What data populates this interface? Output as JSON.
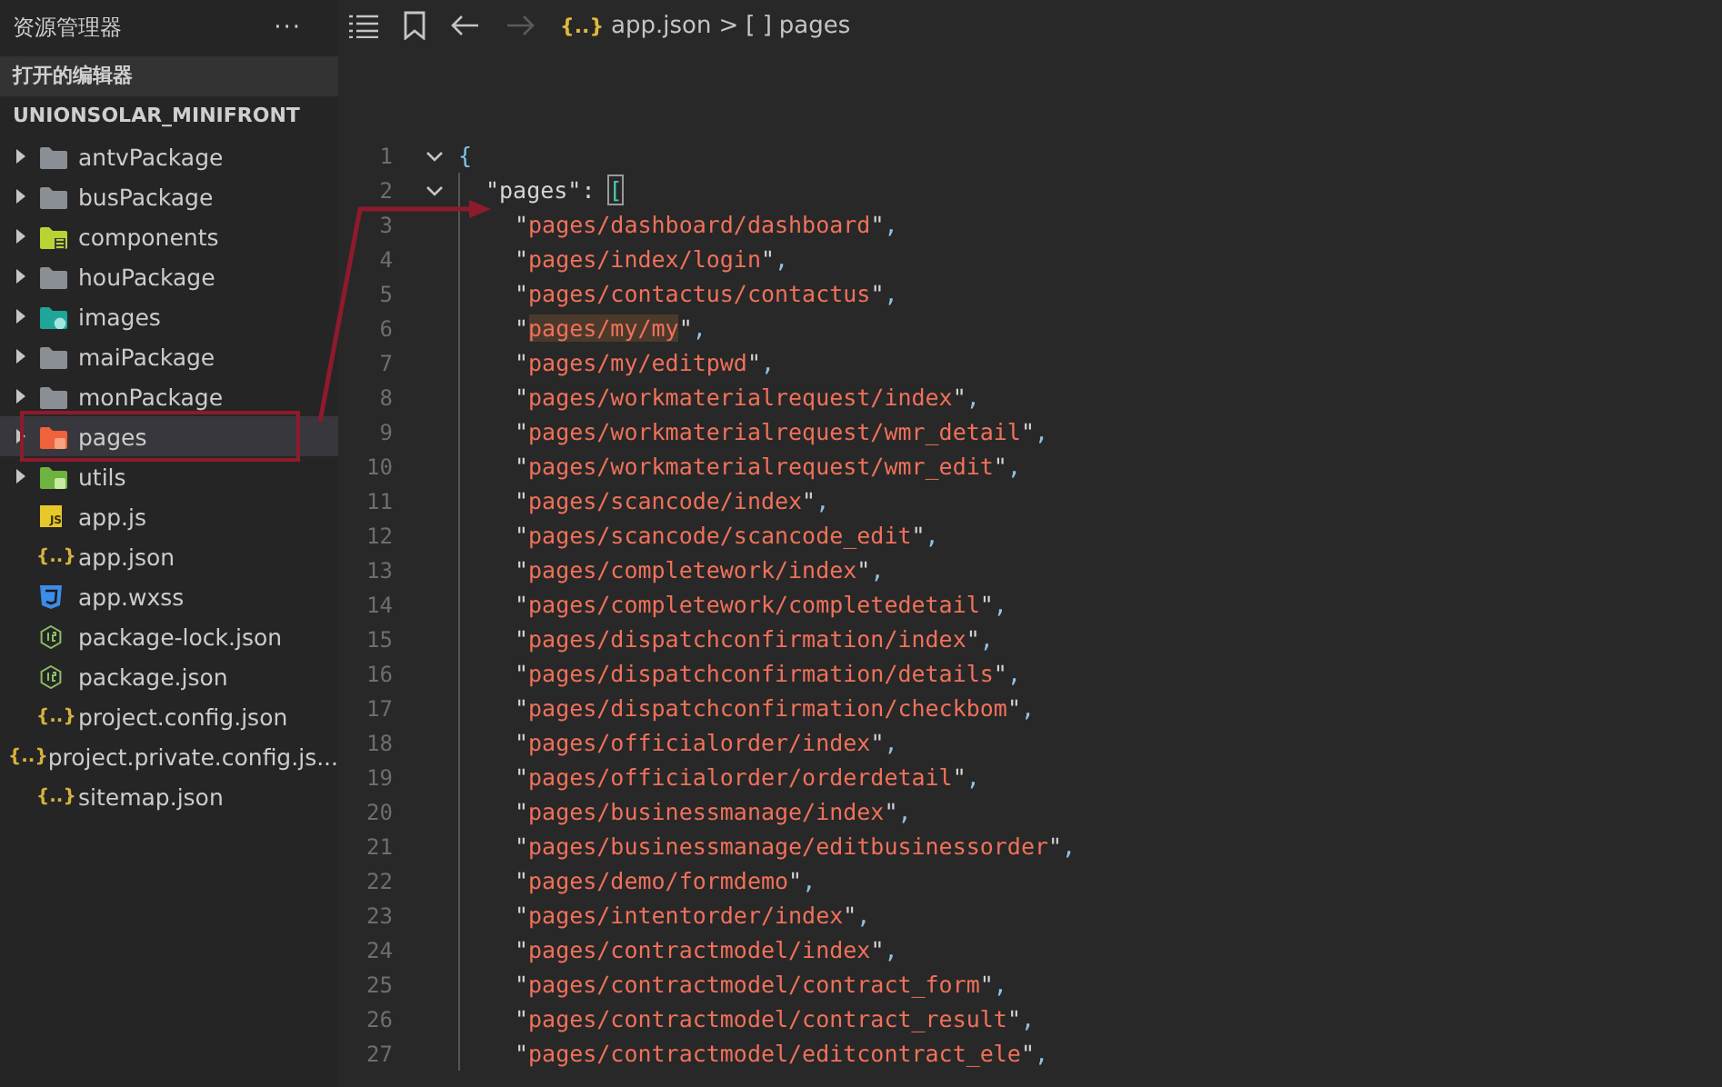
{
  "sidebar": {
    "title": "资源管理器",
    "more": "···",
    "open_editors": "打开的编辑器",
    "project": "UNIONSOLAR_MINIFRONT",
    "items": [
      {
        "kind": "folder",
        "name": "antvPackage",
        "expanded": false,
        "selected": false,
        "annotated": false
      },
      {
        "kind": "folder",
        "name": "busPackage",
        "expanded": false,
        "selected": false,
        "annotated": false
      },
      {
        "kind": "libfolder",
        "name": "components",
        "expanded": false,
        "selected": false,
        "annotated": false
      },
      {
        "kind": "folder",
        "name": "houPackage",
        "expanded": false,
        "selected": false,
        "annotated": false
      },
      {
        "kind": "imgfolder",
        "name": "images",
        "expanded": false,
        "selected": false,
        "annotated": false
      },
      {
        "kind": "folder",
        "name": "maiPackage",
        "expanded": false,
        "selected": false,
        "annotated": false
      },
      {
        "kind": "folder",
        "name": "monPackage",
        "expanded": false,
        "selected": false,
        "annotated": false
      },
      {
        "kind": "pagefolder",
        "name": "pages",
        "expanded": false,
        "selected": true,
        "annotated": true
      },
      {
        "kind": "utilfolder",
        "name": "utils",
        "expanded": false,
        "selected": false,
        "annotated": false
      },
      {
        "kind": "js",
        "glyph": "JS",
        "name": "app.js",
        "selected": false,
        "annotated": false
      },
      {
        "kind": "json",
        "glyph": "{..}",
        "name": "app.json",
        "selected": false,
        "annotated": false
      },
      {
        "kind": "css",
        "name": "app.wxss",
        "selected": false,
        "annotated": false
      },
      {
        "kind": "npm",
        "name": "package-lock.json",
        "selected": false,
        "annotated": false
      },
      {
        "kind": "npm",
        "name": "package.json",
        "selected": false,
        "annotated": false
      },
      {
        "kind": "json",
        "glyph": "{..}",
        "name": "project.config.json",
        "selected": false,
        "annotated": false
      },
      {
        "kind": "json",
        "glyph": "{..}",
        "name": "project.private.config.js...",
        "selected": false,
        "annotated": false
      },
      {
        "kind": "json",
        "glyph": "{..}",
        "name": "sitemap.json",
        "selected": false,
        "annotated": false
      }
    ]
  },
  "breadcrumb": {
    "file_glyph": "{..}",
    "file": "app.json",
    "separator": ">",
    "node_glyph": "[ ]",
    "node": "pages"
  },
  "editor": {
    "lines": [
      {
        "number": "1",
        "foldable": true,
        "tokens": [
          {
            "kind": "brace",
            "text": "{"
          }
        ]
      },
      {
        "number": "2",
        "foldable": true,
        "tokens": [
          {
            "kind": "key",
            "text": "\"pages\""
          },
          {
            "kind": "punct",
            "text": ": "
          },
          {
            "kind": "bracket",
            "text": "[",
            "matched": true
          }
        ]
      },
      {
        "number": "3",
        "foldable": false,
        "tokens": [
          {
            "kind": "quote",
            "text": "\""
          },
          {
            "kind": "string",
            "text": "pages/dashboard/dashboard"
          },
          {
            "kind": "quote",
            "text": "\""
          },
          {
            "kind": "comma",
            "text": ","
          }
        ]
      },
      {
        "number": "4",
        "foldable": false,
        "tokens": [
          {
            "kind": "quote",
            "text": "\""
          },
          {
            "kind": "string",
            "text": "pages/index/login"
          },
          {
            "kind": "quote",
            "text": "\""
          },
          {
            "kind": "comma",
            "text": ","
          }
        ]
      },
      {
        "number": "5",
        "foldable": false,
        "tokens": [
          {
            "kind": "quote",
            "text": "\""
          },
          {
            "kind": "string",
            "text": "pages/contactus/contactus"
          },
          {
            "kind": "quote",
            "text": "\""
          },
          {
            "kind": "comma",
            "text": ","
          }
        ]
      },
      {
        "number": "6",
        "foldable": false,
        "tokens": [
          {
            "kind": "quote",
            "text": "\""
          },
          {
            "kind": "string",
            "text": "pages/my/my",
            "highlighted": true
          },
          {
            "kind": "quote",
            "text": "\""
          },
          {
            "kind": "comma",
            "text": ","
          }
        ]
      },
      {
        "number": "7",
        "foldable": false,
        "tokens": [
          {
            "kind": "quote",
            "text": "\""
          },
          {
            "kind": "string",
            "text": "pages/my/editpwd"
          },
          {
            "kind": "quote",
            "text": "\""
          },
          {
            "kind": "comma",
            "text": ","
          }
        ]
      },
      {
        "number": "8",
        "foldable": false,
        "tokens": [
          {
            "kind": "quote",
            "text": "\""
          },
          {
            "kind": "string",
            "text": "pages/workmaterialrequest/index"
          },
          {
            "kind": "quote",
            "text": "\""
          },
          {
            "kind": "comma",
            "text": ","
          }
        ]
      },
      {
        "number": "9",
        "foldable": false,
        "tokens": [
          {
            "kind": "quote",
            "text": "\""
          },
          {
            "kind": "string",
            "text": "pages/workmaterialrequest/wmr_detail"
          },
          {
            "kind": "quote",
            "text": "\""
          },
          {
            "kind": "comma",
            "text": ","
          }
        ]
      },
      {
        "number": "10",
        "foldable": false,
        "tokens": [
          {
            "kind": "quote",
            "text": "\""
          },
          {
            "kind": "string",
            "text": "pages/workmaterialrequest/wmr_edit"
          },
          {
            "kind": "quote",
            "text": "\""
          },
          {
            "kind": "comma",
            "text": ","
          }
        ]
      },
      {
        "number": "11",
        "foldable": false,
        "tokens": [
          {
            "kind": "quote",
            "text": "\""
          },
          {
            "kind": "string",
            "text": "pages/scancode/index"
          },
          {
            "kind": "quote",
            "text": "\""
          },
          {
            "kind": "comma",
            "text": ","
          }
        ]
      },
      {
        "number": "12",
        "foldable": false,
        "tokens": [
          {
            "kind": "quote",
            "text": "\""
          },
          {
            "kind": "string",
            "text": "pages/scancode/scancode_edit"
          },
          {
            "kind": "quote",
            "text": "\""
          },
          {
            "kind": "comma",
            "text": ","
          }
        ]
      },
      {
        "number": "13",
        "foldable": false,
        "tokens": [
          {
            "kind": "quote",
            "text": "\""
          },
          {
            "kind": "string",
            "text": "pages/completework/index"
          },
          {
            "kind": "quote",
            "text": "\""
          },
          {
            "kind": "comma",
            "text": ","
          }
        ]
      },
      {
        "number": "14",
        "foldable": false,
        "tokens": [
          {
            "kind": "quote",
            "text": "\""
          },
          {
            "kind": "string",
            "text": "pages/completework/completedetail"
          },
          {
            "kind": "quote",
            "text": "\""
          },
          {
            "kind": "comma",
            "text": ","
          }
        ]
      },
      {
        "number": "15",
        "foldable": false,
        "tokens": [
          {
            "kind": "quote",
            "text": "\""
          },
          {
            "kind": "string",
            "text": "pages/dispatchconfirmation/index"
          },
          {
            "kind": "quote",
            "text": "\""
          },
          {
            "kind": "comma",
            "text": ","
          }
        ]
      },
      {
        "number": "16",
        "foldable": false,
        "tokens": [
          {
            "kind": "quote",
            "text": "\""
          },
          {
            "kind": "string",
            "text": "pages/dispatchconfirmation/details"
          },
          {
            "kind": "quote",
            "text": "\""
          },
          {
            "kind": "comma",
            "text": ","
          }
        ]
      },
      {
        "number": "17",
        "foldable": false,
        "tokens": [
          {
            "kind": "quote",
            "text": "\""
          },
          {
            "kind": "string",
            "text": "pages/dispatchconfirmation/checkbom"
          },
          {
            "kind": "quote",
            "text": "\""
          },
          {
            "kind": "comma",
            "text": ","
          }
        ]
      },
      {
        "number": "18",
        "foldable": false,
        "tokens": [
          {
            "kind": "quote",
            "text": "\""
          },
          {
            "kind": "string",
            "text": "pages/officialorder/index"
          },
          {
            "kind": "quote",
            "text": "\""
          },
          {
            "kind": "comma",
            "text": ","
          }
        ]
      },
      {
        "number": "19",
        "foldable": false,
        "tokens": [
          {
            "kind": "quote",
            "text": "\""
          },
          {
            "kind": "string",
            "text": "pages/officialorder/orderdetail"
          },
          {
            "kind": "quote",
            "text": "\""
          },
          {
            "kind": "comma",
            "text": ","
          }
        ]
      },
      {
        "number": "20",
        "foldable": false,
        "tokens": [
          {
            "kind": "quote",
            "text": "\""
          },
          {
            "kind": "string",
            "text": "pages/businessmanage/index"
          },
          {
            "kind": "quote",
            "text": "\""
          },
          {
            "kind": "comma",
            "text": ","
          }
        ]
      },
      {
        "number": "21",
        "foldable": false,
        "tokens": [
          {
            "kind": "quote",
            "text": "\""
          },
          {
            "kind": "string",
            "text": "pages/businessmanage/editbusinessorder"
          },
          {
            "kind": "quote",
            "text": "\""
          },
          {
            "kind": "comma",
            "text": ","
          }
        ]
      },
      {
        "number": "22",
        "foldable": false,
        "tokens": [
          {
            "kind": "quote",
            "text": "\""
          },
          {
            "kind": "string",
            "text": "pages/demo/formdemo"
          },
          {
            "kind": "quote",
            "text": "\""
          },
          {
            "kind": "comma",
            "text": ","
          }
        ]
      },
      {
        "number": "23",
        "foldable": false,
        "tokens": [
          {
            "kind": "quote",
            "text": "\""
          },
          {
            "kind": "string",
            "text": "pages/intentorder/index"
          },
          {
            "kind": "quote",
            "text": "\""
          },
          {
            "kind": "comma",
            "text": ","
          }
        ]
      },
      {
        "number": "24",
        "foldable": false,
        "tokens": [
          {
            "kind": "quote",
            "text": "\""
          },
          {
            "kind": "string",
            "text": "pages/contractmodel/index"
          },
          {
            "kind": "quote",
            "text": "\""
          },
          {
            "kind": "comma",
            "text": ","
          }
        ]
      },
      {
        "number": "25",
        "foldable": false,
        "tokens": [
          {
            "kind": "quote",
            "text": "\""
          },
          {
            "kind": "string",
            "text": "pages/contractmodel/contract_form"
          },
          {
            "kind": "quote",
            "text": "\""
          },
          {
            "kind": "comma",
            "text": ","
          }
        ]
      },
      {
        "number": "26",
        "foldable": false,
        "tokens": [
          {
            "kind": "quote",
            "text": "\""
          },
          {
            "kind": "string",
            "text": "pages/contractmodel/contract_result"
          },
          {
            "kind": "quote",
            "text": "\""
          },
          {
            "kind": "comma",
            "text": ","
          }
        ]
      },
      {
        "number": "27",
        "foldable": false,
        "tokens": [
          {
            "kind": "quote",
            "text": "\""
          },
          {
            "kind": "string",
            "text": "pages/contractmodel/editcontract_ele"
          },
          {
            "kind": "quote",
            "text": "\""
          },
          {
            "kind": "comma",
            "text": ","
          }
        ]
      }
    ]
  }
}
